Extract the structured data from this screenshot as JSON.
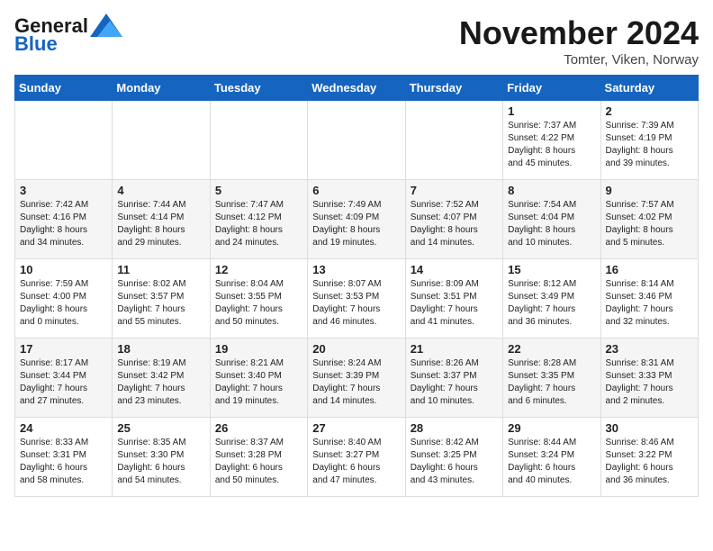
{
  "header": {
    "logo_general": "General",
    "logo_blue": "Blue",
    "month": "November 2024",
    "location": "Tomter, Viken, Norway"
  },
  "weekdays": [
    "Sunday",
    "Monday",
    "Tuesday",
    "Wednesday",
    "Thursday",
    "Friday",
    "Saturday"
  ],
  "weeks": [
    [
      {
        "day": "",
        "info": ""
      },
      {
        "day": "",
        "info": ""
      },
      {
        "day": "",
        "info": ""
      },
      {
        "day": "",
        "info": ""
      },
      {
        "day": "",
        "info": ""
      },
      {
        "day": "1",
        "info": "Sunrise: 7:37 AM\nSunset: 4:22 PM\nDaylight: 8 hours\nand 45 minutes."
      },
      {
        "day": "2",
        "info": "Sunrise: 7:39 AM\nSunset: 4:19 PM\nDaylight: 8 hours\nand 39 minutes."
      }
    ],
    [
      {
        "day": "3",
        "info": "Sunrise: 7:42 AM\nSunset: 4:16 PM\nDaylight: 8 hours\nand 34 minutes."
      },
      {
        "day": "4",
        "info": "Sunrise: 7:44 AM\nSunset: 4:14 PM\nDaylight: 8 hours\nand 29 minutes."
      },
      {
        "day": "5",
        "info": "Sunrise: 7:47 AM\nSunset: 4:12 PM\nDaylight: 8 hours\nand 24 minutes."
      },
      {
        "day": "6",
        "info": "Sunrise: 7:49 AM\nSunset: 4:09 PM\nDaylight: 8 hours\nand 19 minutes."
      },
      {
        "day": "7",
        "info": "Sunrise: 7:52 AM\nSunset: 4:07 PM\nDaylight: 8 hours\nand 14 minutes."
      },
      {
        "day": "8",
        "info": "Sunrise: 7:54 AM\nSunset: 4:04 PM\nDaylight: 8 hours\nand 10 minutes."
      },
      {
        "day": "9",
        "info": "Sunrise: 7:57 AM\nSunset: 4:02 PM\nDaylight: 8 hours\nand 5 minutes."
      }
    ],
    [
      {
        "day": "10",
        "info": "Sunrise: 7:59 AM\nSunset: 4:00 PM\nDaylight: 8 hours\nand 0 minutes."
      },
      {
        "day": "11",
        "info": "Sunrise: 8:02 AM\nSunset: 3:57 PM\nDaylight: 7 hours\nand 55 minutes."
      },
      {
        "day": "12",
        "info": "Sunrise: 8:04 AM\nSunset: 3:55 PM\nDaylight: 7 hours\nand 50 minutes."
      },
      {
        "day": "13",
        "info": "Sunrise: 8:07 AM\nSunset: 3:53 PM\nDaylight: 7 hours\nand 46 minutes."
      },
      {
        "day": "14",
        "info": "Sunrise: 8:09 AM\nSunset: 3:51 PM\nDaylight: 7 hours\nand 41 minutes."
      },
      {
        "day": "15",
        "info": "Sunrise: 8:12 AM\nSunset: 3:49 PM\nDaylight: 7 hours\nand 36 minutes."
      },
      {
        "day": "16",
        "info": "Sunrise: 8:14 AM\nSunset: 3:46 PM\nDaylight: 7 hours\nand 32 minutes."
      }
    ],
    [
      {
        "day": "17",
        "info": "Sunrise: 8:17 AM\nSunset: 3:44 PM\nDaylight: 7 hours\nand 27 minutes."
      },
      {
        "day": "18",
        "info": "Sunrise: 8:19 AM\nSunset: 3:42 PM\nDaylight: 7 hours\nand 23 minutes."
      },
      {
        "day": "19",
        "info": "Sunrise: 8:21 AM\nSunset: 3:40 PM\nDaylight: 7 hours\nand 19 minutes."
      },
      {
        "day": "20",
        "info": "Sunrise: 8:24 AM\nSunset: 3:39 PM\nDaylight: 7 hours\nand 14 minutes."
      },
      {
        "day": "21",
        "info": "Sunrise: 8:26 AM\nSunset: 3:37 PM\nDaylight: 7 hours\nand 10 minutes."
      },
      {
        "day": "22",
        "info": "Sunrise: 8:28 AM\nSunset: 3:35 PM\nDaylight: 7 hours\nand 6 minutes."
      },
      {
        "day": "23",
        "info": "Sunrise: 8:31 AM\nSunset: 3:33 PM\nDaylight: 7 hours\nand 2 minutes."
      }
    ],
    [
      {
        "day": "24",
        "info": "Sunrise: 8:33 AM\nSunset: 3:31 PM\nDaylight: 6 hours\nand 58 minutes."
      },
      {
        "day": "25",
        "info": "Sunrise: 8:35 AM\nSunset: 3:30 PM\nDaylight: 6 hours\nand 54 minutes."
      },
      {
        "day": "26",
        "info": "Sunrise: 8:37 AM\nSunset: 3:28 PM\nDaylight: 6 hours\nand 50 minutes."
      },
      {
        "day": "27",
        "info": "Sunrise: 8:40 AM\nSunset: 3:27 PM\nDaylight: 6 hours\nand 47 minutes."
      },
      {
        "day": "28",
        "info": "Sunrise: 8:42 AM\nSunset: 3:25 PM\nDaylight: 6 hours\nand 43 minutes."
      },
      {
        "day": "29",
        "info": "Sunrise: 8:44 AM\nSunset: 3:24 PM\nDaylight: 6 hours\nand 40 minutes."
      },
      {
        "day": "30",
        "info": "Sunrise: 8:46 AM\nSunset: 3:22 PM\nDaylight: 6 hours\nand 36 minutes."
      }
    ]
  ]
}
